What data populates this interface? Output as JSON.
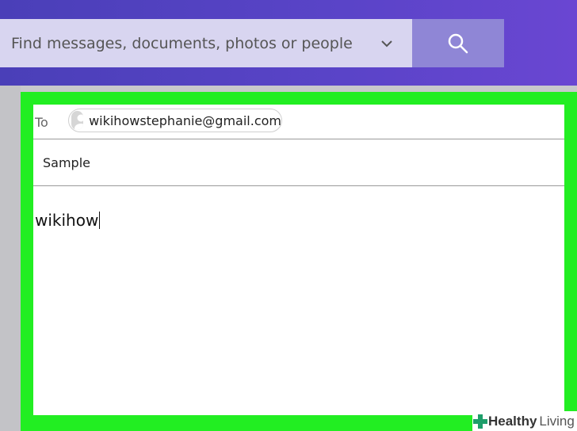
{
  "search": {
    "placeholder": "Find messages, documents, photos or people",
    "value": ""
  },
  "icons": {
    "dropdown": "chevron-down-icon",
    "search": "search-icon",
    "avatar": "avatar-icon"
  },
  "compose": {
    "to_label": "To",
    "recipient": "wikihowstephanie@gmail.com",
    "subject": "Sample",
    "body": "wikihow"
  },
  "watermark": {
    "brand_bold": "Healthy",
    "brand_light": "Living"
  },
  "colors": {
    "header": "#5a44c8",
    "search_field": "#d8d5f0",
    "search_button": "#8f86d6",
    "highlight": "#22ee22"
  }
}
